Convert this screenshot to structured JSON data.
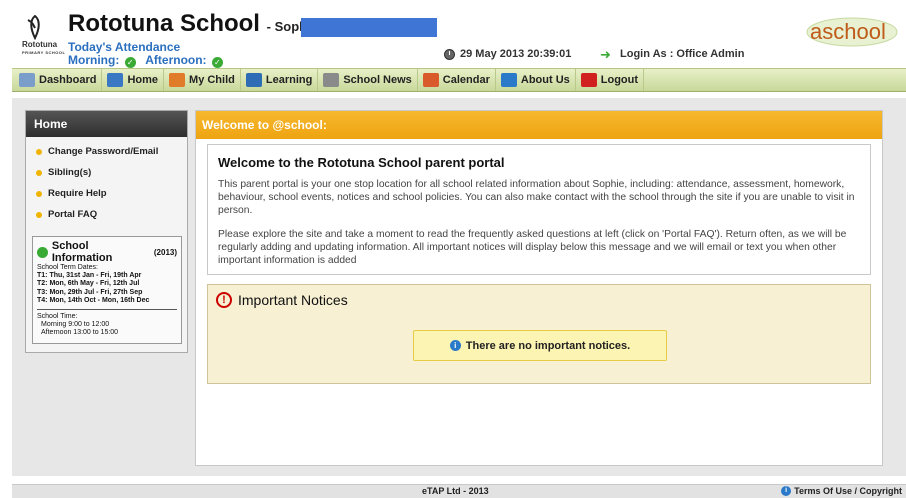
{
  "header": {
    "school_name": "Rototuna School",
    "student_prefix": "- Sophie G",
    "logo_text": "Rototuna",
    "logo_subtext": "PRIMARY SCHOOL",
    "attendance_title": "Today's Attendance",
    "morning_label": "Morning:",
    "afternoon_label": "Afternoon:",
    "datetime": "29 May 2013  20:39:01",
    "login_as": "Login As : Office Admin",
    "brand": "aschool"
  },
  "nav": {
    "items": [
      {
        "label": "Dashboard",
        "icon": "dashboard-icon",
        "color": "#7a9ec9"
      },
      {
        "label": "Home",
        "icon": "home-icon",
        "color": "#3a78c4"
      },
      {
        "label": "My Child",
        "icon": "people-icon",
        "color": "#e07b2a"
      },
      {
        "label": "Learning",
        "icon": "monitor-icon",
        "color": "#2f6cb6"
      },
      {
        "label": "School News",
        "icon": "news-icon",
        "color": "#8a8a8a"
      },
      {
        "label": "Calendar",
        "icon": "calendar-icon",
        "color": "#d95b2b"
      },
      {
        "label": "About Us",
        "icon": "info-icon",
        "color": "#2b79c9"
      },
      {
        "label": "Logout",
        "icon": "power-icon",
        "color": "#d02020"
      }
    ]
  },
  "sidebar": {
    "title": "Home",
    "items": [
      {
        "label": "Change Password/Email"
      },
      {
        "label": "Sibling(s)"
      },
      {
        "label": "Require Help"
      },
      {
        "label": "Portal FAQ"
      }
    ],
    "info": {
      "title": "School Information",
      "year": "(2013)",
      "term_heading": "School Term Dates:",
      "terms": [
        "T1: Thu, 31st Jan - Fri, 19th Apr",
        "T2: Mon, 6th May - Fri, 12th Jul",
        "T3: Mon, 29th Jul - Fri, 27th Sep",
        "T4: Mon, 14th Oct - Mon, 16th Dec"
      ],
      "time_heading": "School Time:",
      "morning": "Morning 9:00 to 12:00",
      "afternoon": "Afternoon 13:00 to 15:00"
    }
  },
  "main": {
    "header": "Welcome to @school:",
    "welcome_title": "Welcome to the Rototuna School parent portal",
    "para1": "This parent portal is your one stop location for all school related information about Sophie, including: attendance, assessment, homework, behaviour, school events, notices and school policies. You can also make contact with the school through the site if you are unable to visit in person.",
    "para2": "Please explore the site and take a moment to read the frequently asked questions at left (click on 'Portal FAQ'). Return often, as we will be regularly adding and updating information. All important notices will display below this message and we will email or text you when other important information is added",
    "notices_title": "Important Notices",
    "no_notices": "There are no important notices."
  },
  "footer": {
    "copyright": "eTAP Ltd - 2013",
    "terms": "Terms Of Use / Copyright"
  }
}
